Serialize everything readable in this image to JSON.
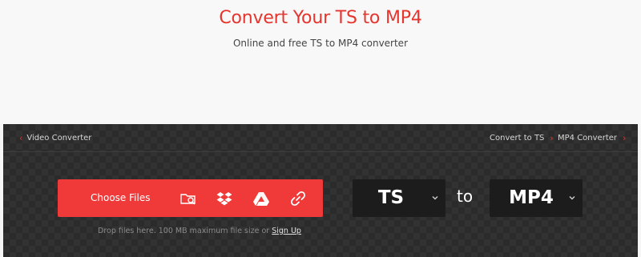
{
  "hero": {
    "title": "Convert Your TS to MP4",
    "subtitle": "Online and free TS to MP4 converter"
  },
  "breadcrumbs": {
    "left": {
      "label": "Video Converter",
      "icon": "chevron-left-icon"
    },
    "right": [
      {
        "label": "Convert to TS",
        "icon": "chevron-right-icon"
      },
      {
        "label": "MP4 Converter",
        "icon": "chevron-right-icon"
      }
    ]
  },
  "upload": {
    "choose_label": "Choose Files",
    "sources": [
      "folder-search-icon",
      "dropbox-icon",
      "google-drive-icon",
      "link-icon"
    ],
    "drop_text": "Drop files here. 100 MB maximum file size or",
    "signup_label": "Sign Up"
  },
  "conversion": {
    "from_format": "TS",
    "to_word": "to",
    "to_format": "MP4"
  },
  "colors": {
    "accent": "#e5352e",
    "button": "#f03a3a",
    "panel": "#2b2b2b",
    "select": "#1c1c1c"
  }
}
